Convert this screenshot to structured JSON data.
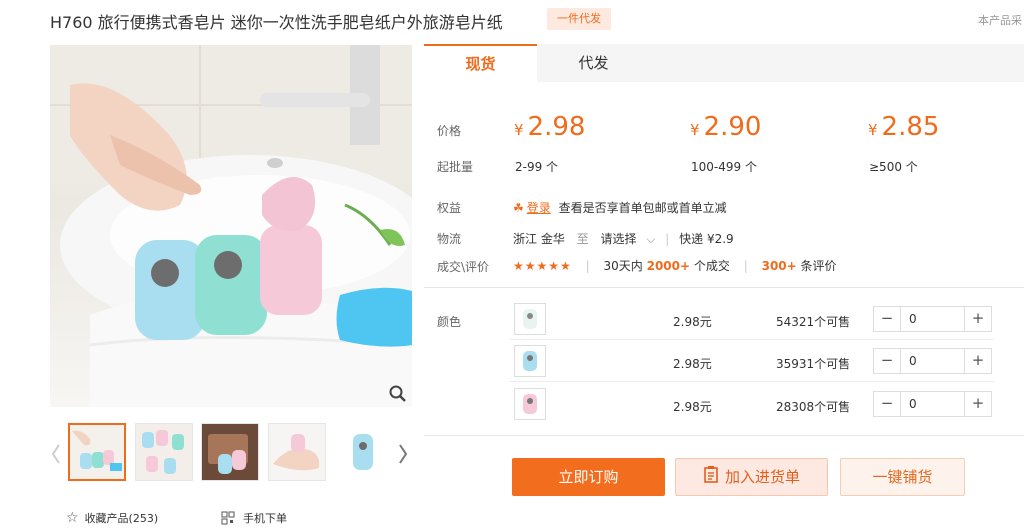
{
  "header": {
    "title": "H760 旅行便携式香皂片 迷你一次性洗手肥皂纸户外旅游皂片纸",
    "badge": "一件代发",
    "topright": "本产品采"
  },
  "gallery": {
    "favorite_label": "收藏产品(253)",
    "mobile_label": "手机下单"
  },
  "tabs": [
    {
      "label": "现货"
    },
    {
      "label": "代发"
    }
  ],
  "pricing": {
    "price_label": "价格",
    "moq_label": "起批量",
    "currency": "¥",
    "tiers": [
      {
        "price": "2.98",
        "range": "2-99 个"
      },
      {
        "price": "2.90",
        "range": "100-499 个"
      },
      {
        "price": "2.85",
        "range": "≥500 个"
      }
    ]
  },
  "benefits": {
    "label": "权益",
    "login": "登录",
    "text": "查看是否享首单包邮或首单立减"
  },
  "logistics": {
    "label": "物流",
    "from": "浙江 金华",
    "to_word": "至",
    "select": "请选择",
    "express": "快递 ¥2.9"
  },
  "deals": {
    "label": "成交\\评价",
    "stars": "★★★★★",
    "prefix": "30天内",
    "count": "2000+",
    "suffix": "个成交",
    "reviews": "300+",
    "reviews_suffix": "条评价"
  },
  "sku": {
    "label": "颜色",
    "items": [
      {
        "color": "white",
        "price": "2.98元",
        "stock": "54321个可售",
        "qty": "0"
      },
      {
        "color": "blue",
        "price": "2.98元",
        "stock": "35931个可售",
        "qty": "0"
      },
      {
        "color": "pink",
        "price": "2.98元",
        "stock": "28308个可售",
        "qty": "0"
      }
    ]
  },
  "actions": {
    "buy": "立即订购",
    "cart": "加入进货单",
    "distribute": "一键铺货"
  },
  "colors": {
    "accent": "#f06b1c",
    "buy_bg": "#f36d1f"
  }
}
